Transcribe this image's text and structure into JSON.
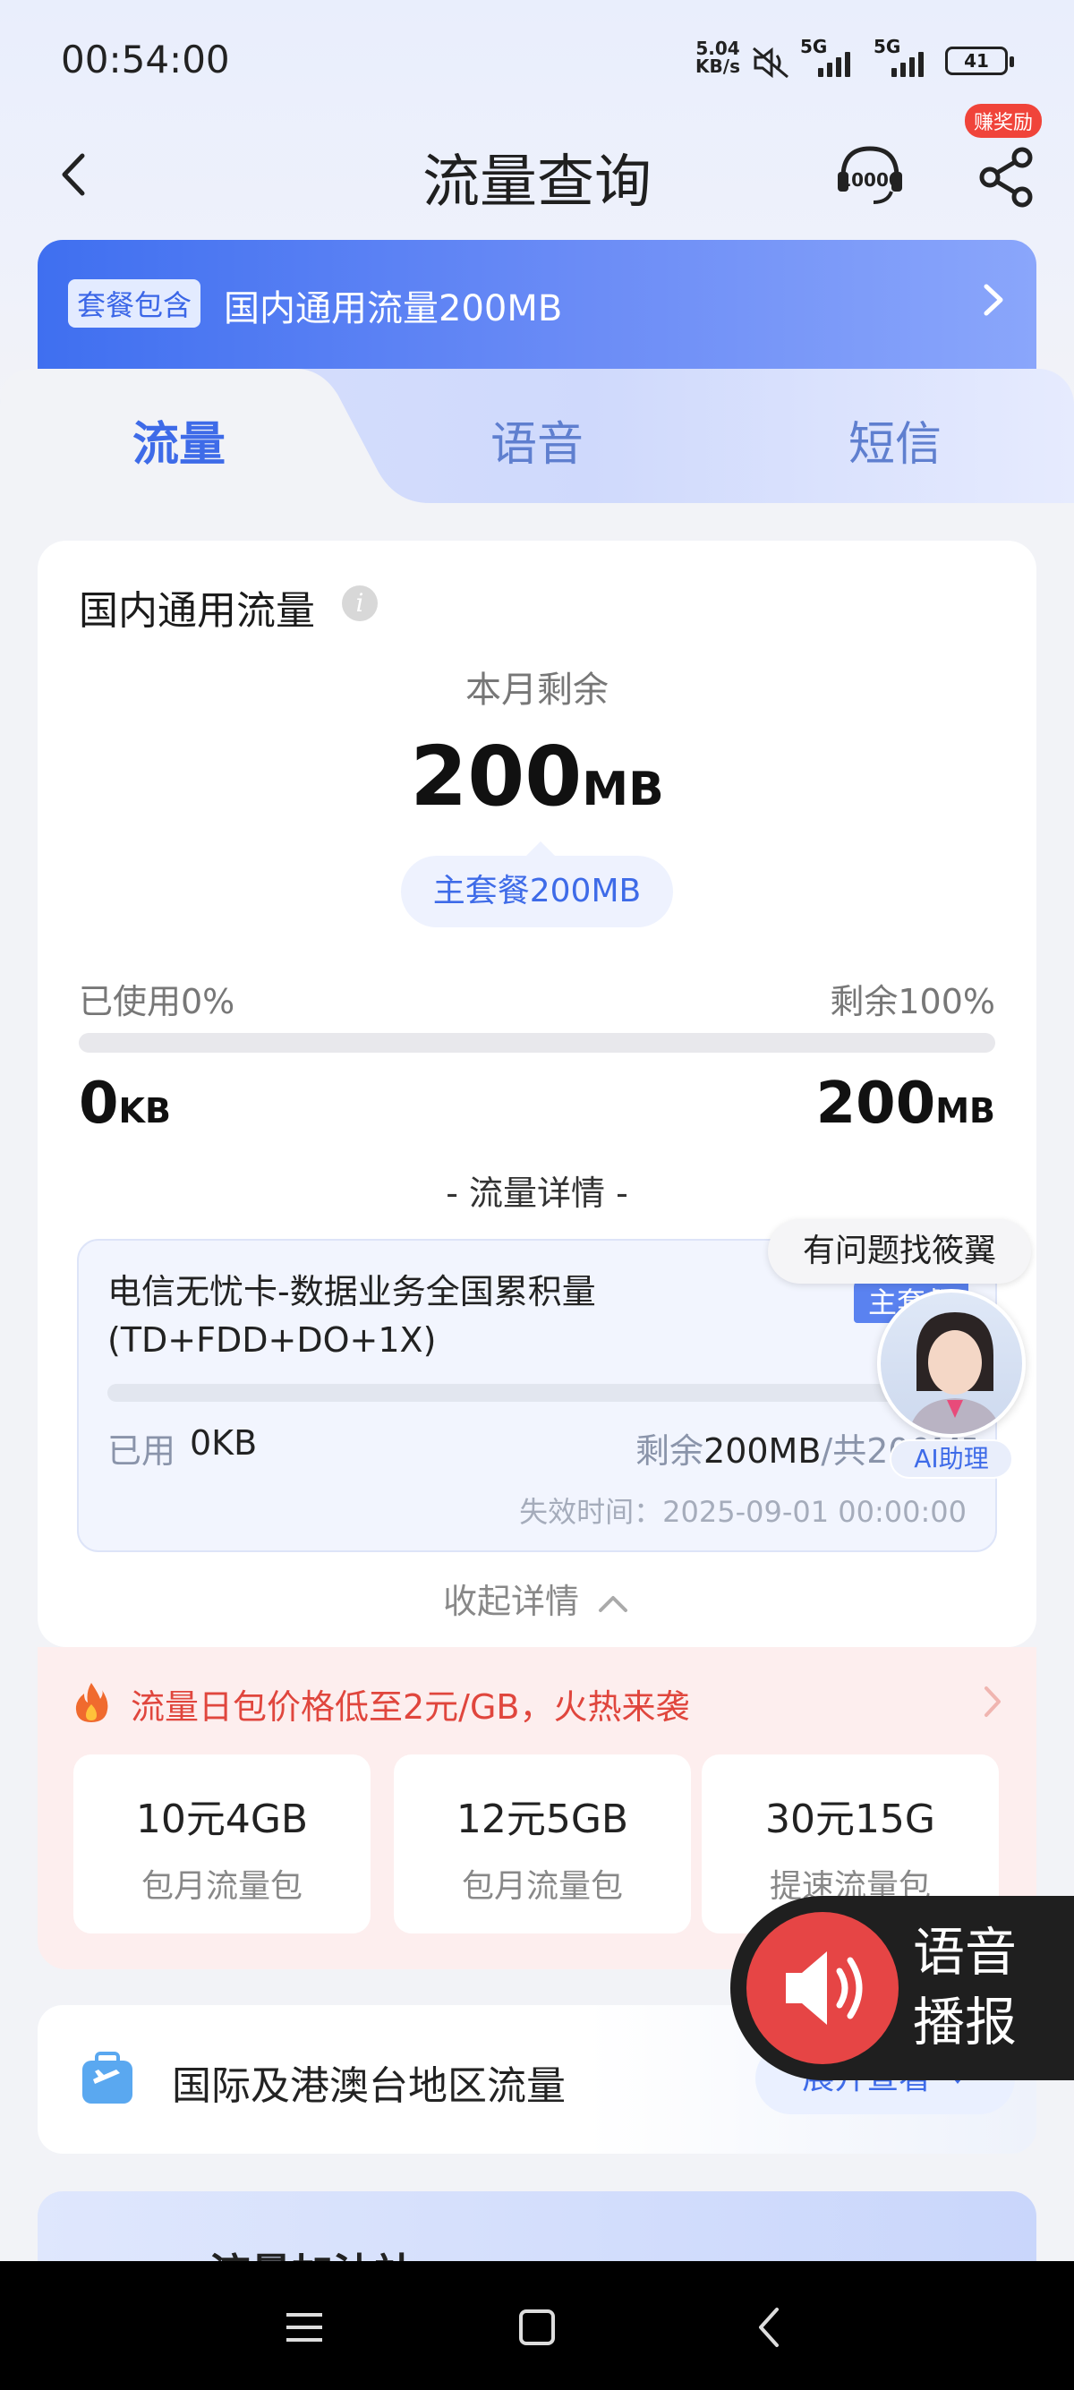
{
  "status_bar": {
    "time": "00:54:00",
    "net_speed_value": "5.04",
    "net_speed_unit": "KB/s",
    "signal1_label": "5G",
    "signal2_label": "5G",
    "battery": "41"
  },
  "header": {
    "title": "流量查询",
    "service_icon": "10000-service-icon",
    "share_icon": "share-icon",
    "reward_badge": "赚奖励"
  },
  "plan_banner": {
    "tag": "套餐包含",
    "text": "国内通用流量200MB"
  },
  "tabs": [
    {
      "label": "流量",
      "active": true
    },
    {
      "label": "语音",
      "active": false
    },
    {
      "label": "短信",
      "active": false
    }
  ],
  "usage": {
    "title": "国内通用流量",
    "remain_label": "本月剩余",
    "remain_number": "200",
    "remain_unit": "MB",
    "package_pill": "主套餐200MB",
    "used_percent_text": "已使用0%",
    "remain_percent_text": "剩余100%",
    "used_fraction": 0,
    "used_number": "0",
    "used_unit": "KB",
    "total_number": "200",
    "total_unit": "MB",
    "detail_heading": "- 流量详情 -"
  },
  "detail_item": {
    "name": "电信无忧卡-数据业务全国累积量(TD+FDD+DO+1X)",
    "tag": "主套餐",
    "used_label": "已用",
    "used_value": "0KB",
    "remain_label": "剩余",
    "remain_value": "200MB",
    "total_text": "/共200MB",
    "expire": "失效时间：2025-09-01 00:00:00"
  },
  "collapse_label": "收起详情",
  "promo": {
    "headline": "流量日包价格低至2元/GB，火热来袭",
    "items": [
      {
        "title": "10元4GB",
        "subtitle": "包月流量包"
      },
      {
        "title": "12元5GB",
        "subtitle": "包月流量包"
      },
      {
        "title": "30元15G",
        "subtitle": "提速流量包"
      }
    ]
  },
  "international": {
    "title": "国际及港澳台地区流量",
    "button": "展开查看"
  },
  "next_card": {
    "title": "流量加油站"
  },
  "floating": {
    "help_text": "有问题找筱翼",
    "ai_label": "AI助理",
    "voice_text_line1": "语音",
    "voice_text_line2": "播报"
  },
  "colors": {
    "accent": "#3e6be8",
    "promo_red": "#e0463d",
    "voice_red": "#e64545"
  }
}
